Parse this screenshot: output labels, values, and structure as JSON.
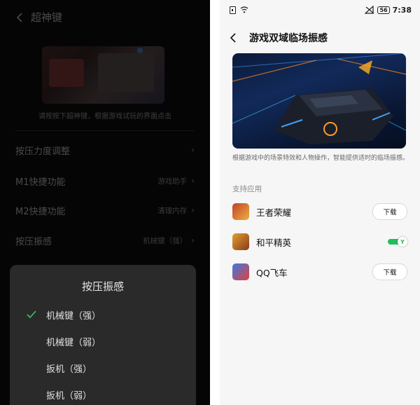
{
  "left": {
    "title": "超神键",
    "hint": "请按按下超神键，根据游戏试玩的界面点击",
    "settings": [
      {
        "label": "按压力度调整",
        "value": ""
      },
      {
        "label": "M1快捷功能",
        "value": "游戏助手"
      },
      {
        "label": "M2快捷功能",
        "value": "清理内存"
      },
      {
        "label": "按压振感",
        "value": "机械键（强）"
      }
    ],
    "sheet": {
      "title": "按压振感",
      "options": [
        {
          "label": "机械键（强）",
          "selected": true
        },
        {
          "label": "机械键（弱）",
          "selected": false
        },
        {
          "label": "扳机（强）",
          "selected": false
        },
        {
          "label": "扳机（弱）",
          "selected": false
        }
      ]
    }
  },
  "right": {
    "status": {
      "battery": "56",
      "time": "7:38"
    },
    "title": "游戏双域临场振感",
    "description": "根据游戏中的场景特效和人物操作，智能提供适时的临场振感。",
    "section_label": "支持应用",
    "apps": [
      {
        "name": "王者荣耀",
        "action": "下载",
        "icon": "wangzhe-icon"
      },
      {
        "name": "和平精英",
        "action": "toggle-on",
        "icon": "heping-icon"
      },
      {
        "name": "QQ飞车",
        "action": "下载",
        "icon": "qqfeiche-icon"
      }
    ]
  },
  "colors": {
    "accent_green": "#1fbf5a",
    "dark_bg": "#050505",
    "sheet_bg": "#2a2a2a",
    "check_green": "#3cc46a"
  }
}
